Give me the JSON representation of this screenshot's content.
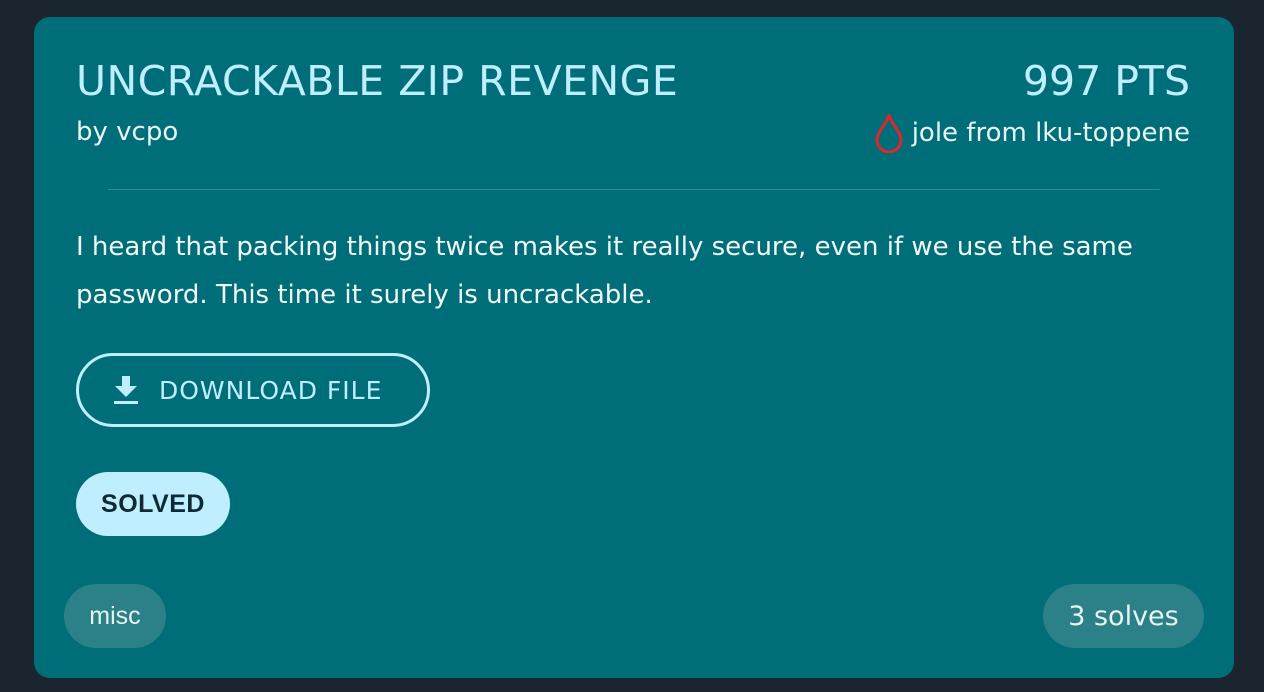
{
  "challenge": {
    "title": "UNCRACKABLE ZIP REVENGE",
    "author": "by vcpo",
    "points": "997 PTS",
    "first_blood": {
      "icon": "blood-drop-icon",
      "icon_color": "#e0262b",
      "text": "jole from lku-toppene"
    },
    "description": "I heard that packing things twice makes it really secure, even if we use the same password. This time it surely is uncrackable.",
    "download": {
      "icon": "download-icon",
      "label": "DOWNLOAD FILE"
    },
    "status_badge": "SOLVED",
    "category": "misc",
    "solves": "3 solves"
  },
  "colors": {
    "page_background": "#1b2530",
    "card_background": "#006e78",
    "accent": "#bfeeff",
    "pill_background": "#2c8088"
  }
}
